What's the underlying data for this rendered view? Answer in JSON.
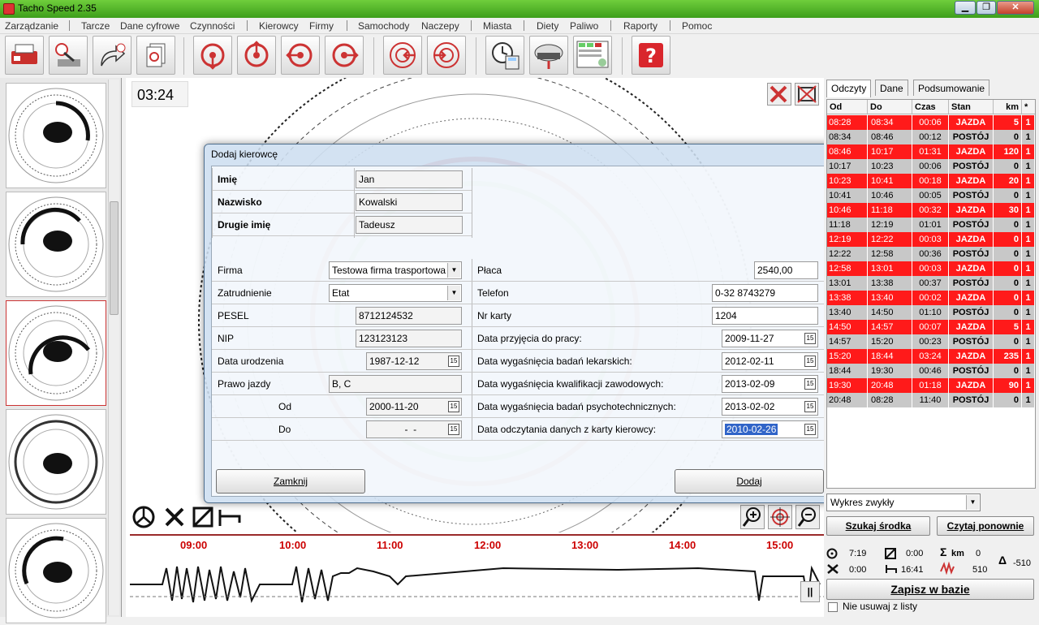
{
  "window": {
    "title": "Tacho Speed 2.35"
  },
  "menu": [
    "Zarządzanie",
    "Tarcze",
    "Dane cyfrowe",
    "Czynności",
    "Kierowcy",
    "Firmy",
    "Samochody",
    "Naczepy",
    "Miasta",
    "Diety",
    "Paliwo",
    "Raporty",
    "Pomoc"
  ],
  "chart": {
    "time": "03:24"
  },
  "timeline": {
    "labels": [
      "09:00",
      "10:00",
      "11:00",
      "12:00",
      "13:00",
      "14:00",
      "15:00"
    ]
  },
  "dialog": {
    "title": "Dodaj kierowcę",
    "imie": {
      "label": "Imię",
      "value": "Jan"
    },
    "nazwisko": {
      "label": "Nazwisko",
      "value": "Kowalski"
    },
    "drugie_imie": {
      "label": "Drugie imię",
      "value": "Tadeusz"
    },
    "firma": {
      "label": "Firma",
      "value": "Testowa firma trasportowa"
    },
    "zatrudnienie": {
      "label": "Zatrudnienie",
      "value": "Etat"
    },
    "pesel": {
      "label": "PESEL",
      "value": "8712124532"
    },
    "nip": {
      "label": "NIP",
      "value": "123123123"
    },
    "data_urodzenia": {
      "label": "Data urodzenia",
      "value": "1987-12-12"
    },
    "prawo_jazdy": {
      "label": "Prawo jazdy",
      "value": "B, C"
    },
    "od": {
      "label": "Od",
      "value": "2000-11-20"
    },
    "do": {
      "label": "Do",
      "value": "  -  -"
    },
    "placa": {
      "label": "Płaca",
      "value": "2540,00"
    },
    "telefon": {
      "label": "Telefon",
      "value": "0-32 8743279"
    },
    "nr_karty": {
      "label": "Nr karty",
      "value": "1204"
    },
    "data_przyjecia": {
      "label": "Data przyjęcia do pracy:",
      "value": "2009-11-27"
    },
    "badania_lekarskie": {
      "label": "Data wygaśnięcia badań lekarskich:",
      "value": "2012-02-11"
    },
    "kwalifikacje": {
      "label": "Data wygaśnięcia kwalifikacji zawodowych:",
      "value": "2013-02-09"
    },
    "psychotechniczne": {
      "label": "Data wygaśnięcia badań psychotechnicznych:",
      "value": "2013-02-02"
    },
    "odczyt_karty": {
      "label": "Data odczytania danych z karty kierowcy:",
      "value": "2010-02-26"
    },
    "close_label": "Zamknij",
    "add_label": "Dodaj"
  },
  "right": {
    "tabs": [
      "Odczyty",
      "Dane",
      "Podsumowanie"
    ],
    "columns": [
      "Od",
      "Do",
      "Czas",
      "Stan",
      "km",
      "*"
    ],
    "rows": [
      {
        "od": "08:28",
        "do": "08:34",
        "czas": "00:06",
        "stan": "JAZDA",
        "km": "5",
        "s": "1",
        "type": "red"
      },
      {
        "od": "08:34",
        "do": "08:46",
        "czas": "00:12",
        "stan": "POSTÓJ",
        "km": "0",
        "s": "1",
        "type": "gray"
      },
      {
        "od": "08:46",
        "do": "10:17",
        "czas": "01:31",
        "stan": "JAZDA",
        "km": "120",
        "s": "1",
        "type": "red"
      },
      {
        "od": "10:17",
        "do": "10:23",
        "czas": "00:06",
        "stan": "POSTÓJ",
        "km": "0",
        "s": "1",
        "type": "gray"
      },
      {
        "od": "10:23",
        "do": "10:41",
        "czas": "00:18",
        "stan": "JAZDA",
        "km": "20",
        "s": "1",
        "type": "red"
      },
      {
        "od": "10:41",
        "do": "10:46",
        "czas": "00:05",
        "stan": "POSTÓJ",
        "km": "0",
        "s": "1",
        "type": "gray"
      },
      {
        "od": "10:46",
        "do": "11:18",
        "czas": "00:32",
        "stan": "JAZDA",
        "km": "30",
        "s": "1",
        "type": "red"
      },
      {
        "od": "11:18",
        "do": "12:19",
        "czas": "01:01",
        "stan": "POSTÓJ",
        "km": "0",
        "s": "1",
        "type": "gray"
      },
      {
        "od": "12:19",
        "do": "12:22",
        "czas": "00:03",
        "stan": "JAZDA",
        "km": "0",
        "s": "1",
        "type": "red"
      },
      {
        "od": "12:22",
        "do": "12:58",
        "czas": "00:36",
        "stan": "POSTÓJ",
        "km": "0",
        "s": "1",
        "type": "gray"
      },
      {
        "od": "12:58",
        "do": "13:01",
        "czas": "00:03",
        "stan": "JAZDA",
        "km": "0",
        "s": "1",
        "type": "red"
      },
      {
        "od": "13:01",
        "do": "13:38",
        "czas": "00:37",
        "stan": "POSTÓJ",
        "km": "0",
        "s": "1",
        "type": "gray"
      },
      {
        "od": "13:38",
        "do": "13:40",
        "czas": "00:02",
        "stan": "JAZDA",
        "km": "0",
        "s": "1",
        "type": "red"
      },
      {
        "od": "13:40",
        "do": "14:50",
        "czas": "01:10",
        "stan": "POSTÓJ",
        "km": "0",
        "s": "1",
        "type": "gray"
      },
      {
        "od": "14:50",
        "do": "14:57",
        "czas": "00:07",
        "stan": "JAZDA",
        "km": "5",
        "s": "1",
        "type": "red"
      },
      {
        "od": "14:57",
        "do": "15:20",
        "czas": "00:23",
        "stan": "POSTÓJ",
        "km": "0",
        "s": "1",
        "type": "gray"
      },
      {
        "od": "15:20",
        "do": "18:44",
        "czas": "03:24",
        "stan": "JAZDA",
        "km": "235",
        "s": "1",
        "type": "red"
      },
      {
        "od": "18:44",
        "do": "19:30",
        "czas": "00:46",
        "stan": "POSTÓJ",
        "km": "0",
        "s": "1",
        "type": "gray"
      },
      {
        "od": "19:30",
        "do": "20:48",
        "czas": "01:18",
        "stan": "JAZDA",
        "km": "90",
        "s": "1",
        "type": "red"
      },
      {
        "od": "20:48",
        "do": "08:28",
        "czas": "11:40",
        "stan": "POSTÓJ",
        "km": "0",
        "s": "1",
        "type": "gray"
      }
    ],
    "wykres": "Wykres zwykły",
    "szukaj": "Szukaj środka",
    "czytaj": "Czytaj ponownie",
    "stats": {
      "jazda": "7:19",
      "praca": "0:00",
      "inne": "0:00",
      "postoj": "16:41",
      "km_label": "km",
      "km": "0",
      "odo": "510",
      "delta": "-510"
    },
    "zapisz": "Zapisz w bazie",
    "nie_usuwaj": "Nie usuwaj z listy"
  }
}
